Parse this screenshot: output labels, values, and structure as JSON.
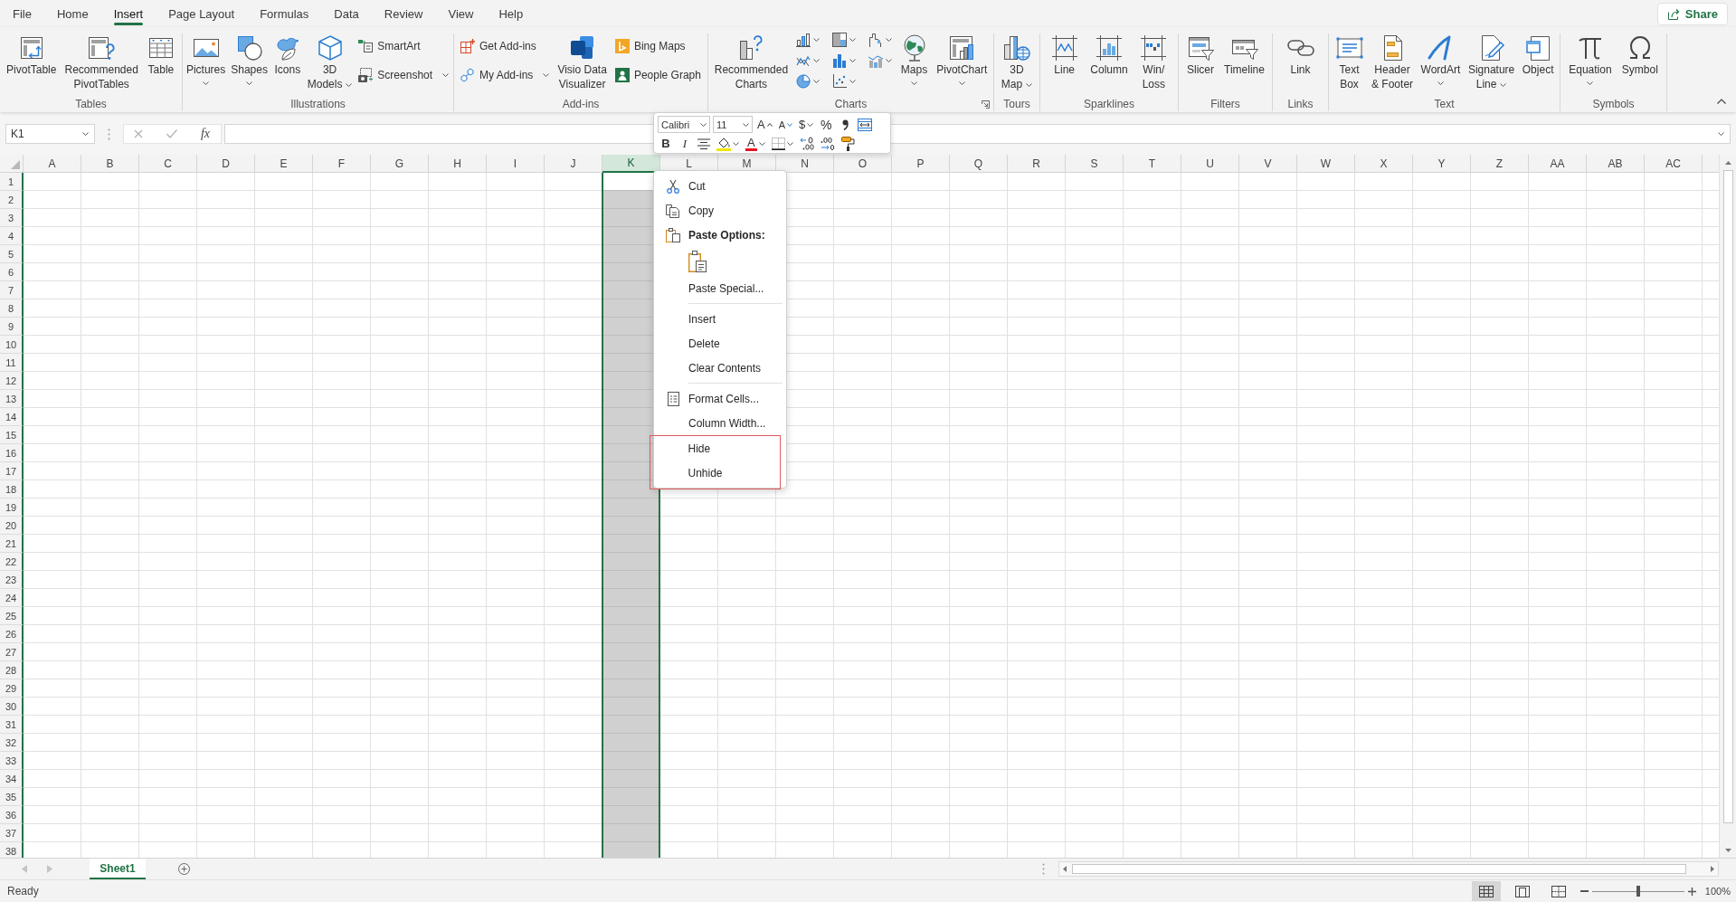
{
  "menu_tabs": [
    {
      "label": "File",
      "selected": false
    },
    {
      "label": "Home",
      "selected": false
    },
    {
      "label": "Insert",
      "selected": true
    },
    {
      "label": "Page Layout",
      "selected": false
    },
    {
      "label": "Formulas",
      "selected": false
    },
    {
      "label": "Data",
      "selected": false
    },
    {
      "label": "Review",
      "selected": false
    },
    {
      "label": "View",
      "selected": false
    },
    {
      "label": "Help",
      "selected": false
    }
  ],
  "share_button": {
    "label": "Share"
  },
  "ribbon": {
    "groups": [
      {
        "label": "Tables",
        "launcher": false,
        "controls": [
          {
            "kind": "large",
            "label": "PivotTable",
            "dropdown": false
          },
          {
            "kind": "large",
            "label": "Recommended\nPivotTables",
            "dropdown": false
          },
          {
            "kind": "large",
            "label": "Table",
            "dropdown": false
          }
        ]
      },
      {
        "label": "Illustrations",
        "launcher": false,
        "controls": [
          {
            "kind": "large",
            "label": "Pictures",
            "dropdown": true
          },
          {
            "kind": "large",
            "label": "Shapes",
            "dropdown": true
          },
          {
            "kind": "large",
            "label": "Icons",
            "dropdown": false
          },
          {
            "kind": "large",
            "label": "3D\nModels",
            "dropdown": true
          },
          {
            "kind": "stack",
            "items": [
              {
                "label": "SmartArt",
                "dropdown": false
              },
              {
                "label": "Screenshot",
                "dropdown": true
              }
            ]
          }
        ]
      },
      {
        "label": "Add-ins",
        "launcher": false,
        "controls": [
          {
            "kind": "stack",
            "items": [
              {
                "label": "Get Add-ins",
                "dropdown": false
              },
              {
                "label": "My Add-ins",
                "dropdown": true
              }
            ]
          },
          {
            "kind": "large",
            "label": "Visio Data\nVisualizer",
            "dropdown": false
          },
          {
            "kind": "stack",
            "items": [
              {
                "label": "Bing Maps",
                "dropdown": false
              },
              {
                "label": "People Graph",
                "dropdown": false
              }
            ]
          }
        ]
      },
      {
        "label": "Charts",
        "launcher": true,
        "controls": [
          {
            "kind": "large",
            "label": "Recommended\nCharts",
            "dropdown": false
          },
          {
            "kind": "gallery"
          },
          {
            "kind": "large",
            "label": "Maps",
            "dropdown": true
          },
          {
            "kind": "large",
            "label": "PivotChart",
            "dropdown": true
          }
        ]
      },
      {
        "label": "Tours",
        "launcher": false,
        "controls": [
          {
            "kind": "large",
            "label": "3D\nMap",
            "dropdown": true
          }
        ]
      },
      {
        "label": "Sparklines",
        "launcher": false,
        "controls": [
          {
            "kind": "large",
            "label": "Line",
            "dropdown": false
          },
          {
            "kind": "large",
            "label": "Column",
            "dropdown": false
          },
          {
            "kind": "large",
            "label": "Win/\nLoss",
            "dropdown": false
          }
        ]
      },
      {
        "label": "Filters",
        "launcher": false,
        "controls": [
          {
            "kind": "large",
            "label": "Slicer",
            "dropdown": false
          },
          {
            "kind": "large",
            "label": "Timeline",
            "dropdown": false
          }
        ]
      },
      {
        "label": "Links",
        "launcher": false,
        "controls": [
          {
            "kind": "large",
            "label": "Link",
            "dropdown": false
          }
        ]
      },
      {
        "label": "Text",
        "launcher": false,
        "controls": [
          {
            "kind": "large",
            "label": "Text\nBox",
            "dropdown": false
          },
          {
            "kind": "large",
            "label": "Header\n& Footer",
            "dropdown": false
          },
          {
            "kind": "large",
            "label": "WordArt",
            "dropdown": true
          },
          {
            "kind": "large",
            "label": "Signature\nLine",
            "dropdown": true
          },
          {
            "kind": "large",
            "label": "Object",
            "dropdown": false
          }
        ]
      },
      {
        "label": "Symbols",
        "launcher": false,
        "controls": [
          {
            "kind": "large",
            "label": "Equation",
            "dropdown": true
          },
          {
            "kind": "large",
            "label": "Symbol",
            "dropdown": false
          }
        ]
      }
    ]
  },
  "formula_bar": {
    "name_box": "K1",
    "cancel": {
      "disabled": true
    },
    "enter": {
      "disabled": true
    },
    "function_button": "fx"
  },
  "mini_toolbar": {
    "upper_row": [
      {
        "kind": "font",
        "value": "Calibri",
        "dropdown": true
      },
      {
        "kind": "size",
        "value": "11",
        "dropdown": true
      },
      {
        "kind": "grow",
        "label": "A",
        "dropdown": false
      },
      {
        "kind": "shrink",
        "label": "A",
        "dropdown": false
      },
      {
        "kind": "currency",
        "label": "$",
        "dropdown": true
      },
      {
        "kind": "percent",
        "label": "%",
        "dropdown": false
      },
      {
        "kind": "comma",
        "dropdown": false
      },
      {
        "kind": "wrap",
        "dropdown": false
      }
    ],
    "lower_row": [
      {
        "kind": "bold",
        "label": "B",
        "dropdown": false
      },
      {
        "kind": "italic",
        "label": "I",
        "dropdown": false
      },
      {
        "kind": "center",
        "dropdown": false
      },
      {
        "kind": "fill",
        "dropdown": true
      },
      {
        "kind": "font_color",
        "label": "A",
        "dropdown": true
      },
      {
        "kind": "borders",
        "dropdown": true
      },
      {
        "kind": "decrease_decimal",
        "dropdown": false
      },
      {
        "kind": "increase_decimal",
        "dropdown": false
      },
      {
        "kind": "painter",
        "dropdown": false
      }
    ]
  },
  "grid": {
    "columns": [
      {
        "label": "A",
        "selected": false
      },
      {
        "label": "B",
        "selected": false
      },
      {
        "label": "C",
        "selected": false
      },
      {
        "label": "D",
        "selected": false
      },
      {
        "label": "E",
        "selected": false
      },
      {
        "label": "F",
        "selected": false
      },
      {
        "label": "G",
        "selected": false
      },
      {
        "label": "H",
        "selected": false
      },
      {
        "label": "I",
        "selected": false
      },
      {
        "label": "J",
        "selected": false
      },
      {
        "label": "K",
        "selected": true
      },
      {
        "label": "L",
        "selected": false
      },
      {
        "label": "M",
        "selected": false
      },
      {
        "label": "N",
        "selected": false
      },
      {
        "label": "O",
        "selected": false
      },
      {
        "label": "P",
        "selected": false
      },
      {
        "label": "Q",
        "selected": false
      },
      {
        "label": "R",
        "selected": false
      },
      {
        "label": "S",
        "selected": false
      },
      {
        "label": "T",
        "selected": false
      },
      {
        "label": "U",
        "selected": false
      },
      {
        "label": "V",
        "selected": false
      },
      {
        "label": "W",
        "selected": false
      },
      {
        "label": "X",
        "selected": false
      },
      {
        "label": "Y",
        "selected": false
      },
      {
        "label": "Z",
        "selected": false
      },
      {
        "label": "AA",
        "selected": false
      },
      {
        "label": "AB",
        "selected": false
      },
      {
        "label": "AC",
        "selected": false
      }
    ],
    "rows": [
      "1",
      "2",
      "3",
      "4",
      "5",
      "6",
      "7",
      "8",
      "9",
      "10",
      "11",
      "12",
      "13",
      "14",
      "15",
      "16",
      "17",
      "18",
      "19",
      "20",
      "21",
      "22",
      "23",
      "24",
      "25",
      "26",
      "27",
      "28",
      "29",
      "30",
      "31",
      "32",
      "33",
      "34",
      "35",
      "36",
      "37",
      "38"
    ]
  },
  "context_menu": {
    "items": [
      {
        "kind": "command",
        "label": "Cut",
        "highlighted": false
      },
      {
        "kind": "command",
        "label": "Copy",
        "highlighted": false
      },
      {
        "kind": "heading",
        "label": "Paste Options:",
        "highlighted": false
      },
      {
        "kind": "paste_options",
        "highlighted": false
      },
      {
        "kind": "command",
        "label": "Paste Special...",
        "highlighted": false
      },
      {
        "kind": "separator",
        "highlighted": false
      },
      {
        "kind": "command",
        "label": "Insert",
        "highlighted": false
      },
      {
        "kind": "command",
        "label": "Delete",
        "highlighted": false
      },
      {
        "kind": "command",
        "label": "Clear Contents",
        "highlighted": false
      },
      {
        "kind": "separator",
        "highlighted": false
      },
      {
        "kind": "command",
        "label": "Format Cells...",
        "highlighted": false
      },
      {
        "kind": "command",
        "label": "Column Width...",
        "highlighted": false
      },
      {
        "kind": "command",
        "label": "Hide",
        "highlighted": true
      },
      {
        "kind": "command",
        "label": "Unhide",
        "highlighted": true
      }
    ]
  },
  "sheet_tabs": [
    {
      "label": "Sheet1",
      "selected": true
    }
  ],
  "status_bar": {
    "text": "Ready",
    "views": [
      {
        "selected": true
      },
      {
        "selected": false
      },
      {
        "selected": false
      }
    ],
    "zoom": {
      "level": 0.5,
      "reading": "100%"
    }
  }
}
